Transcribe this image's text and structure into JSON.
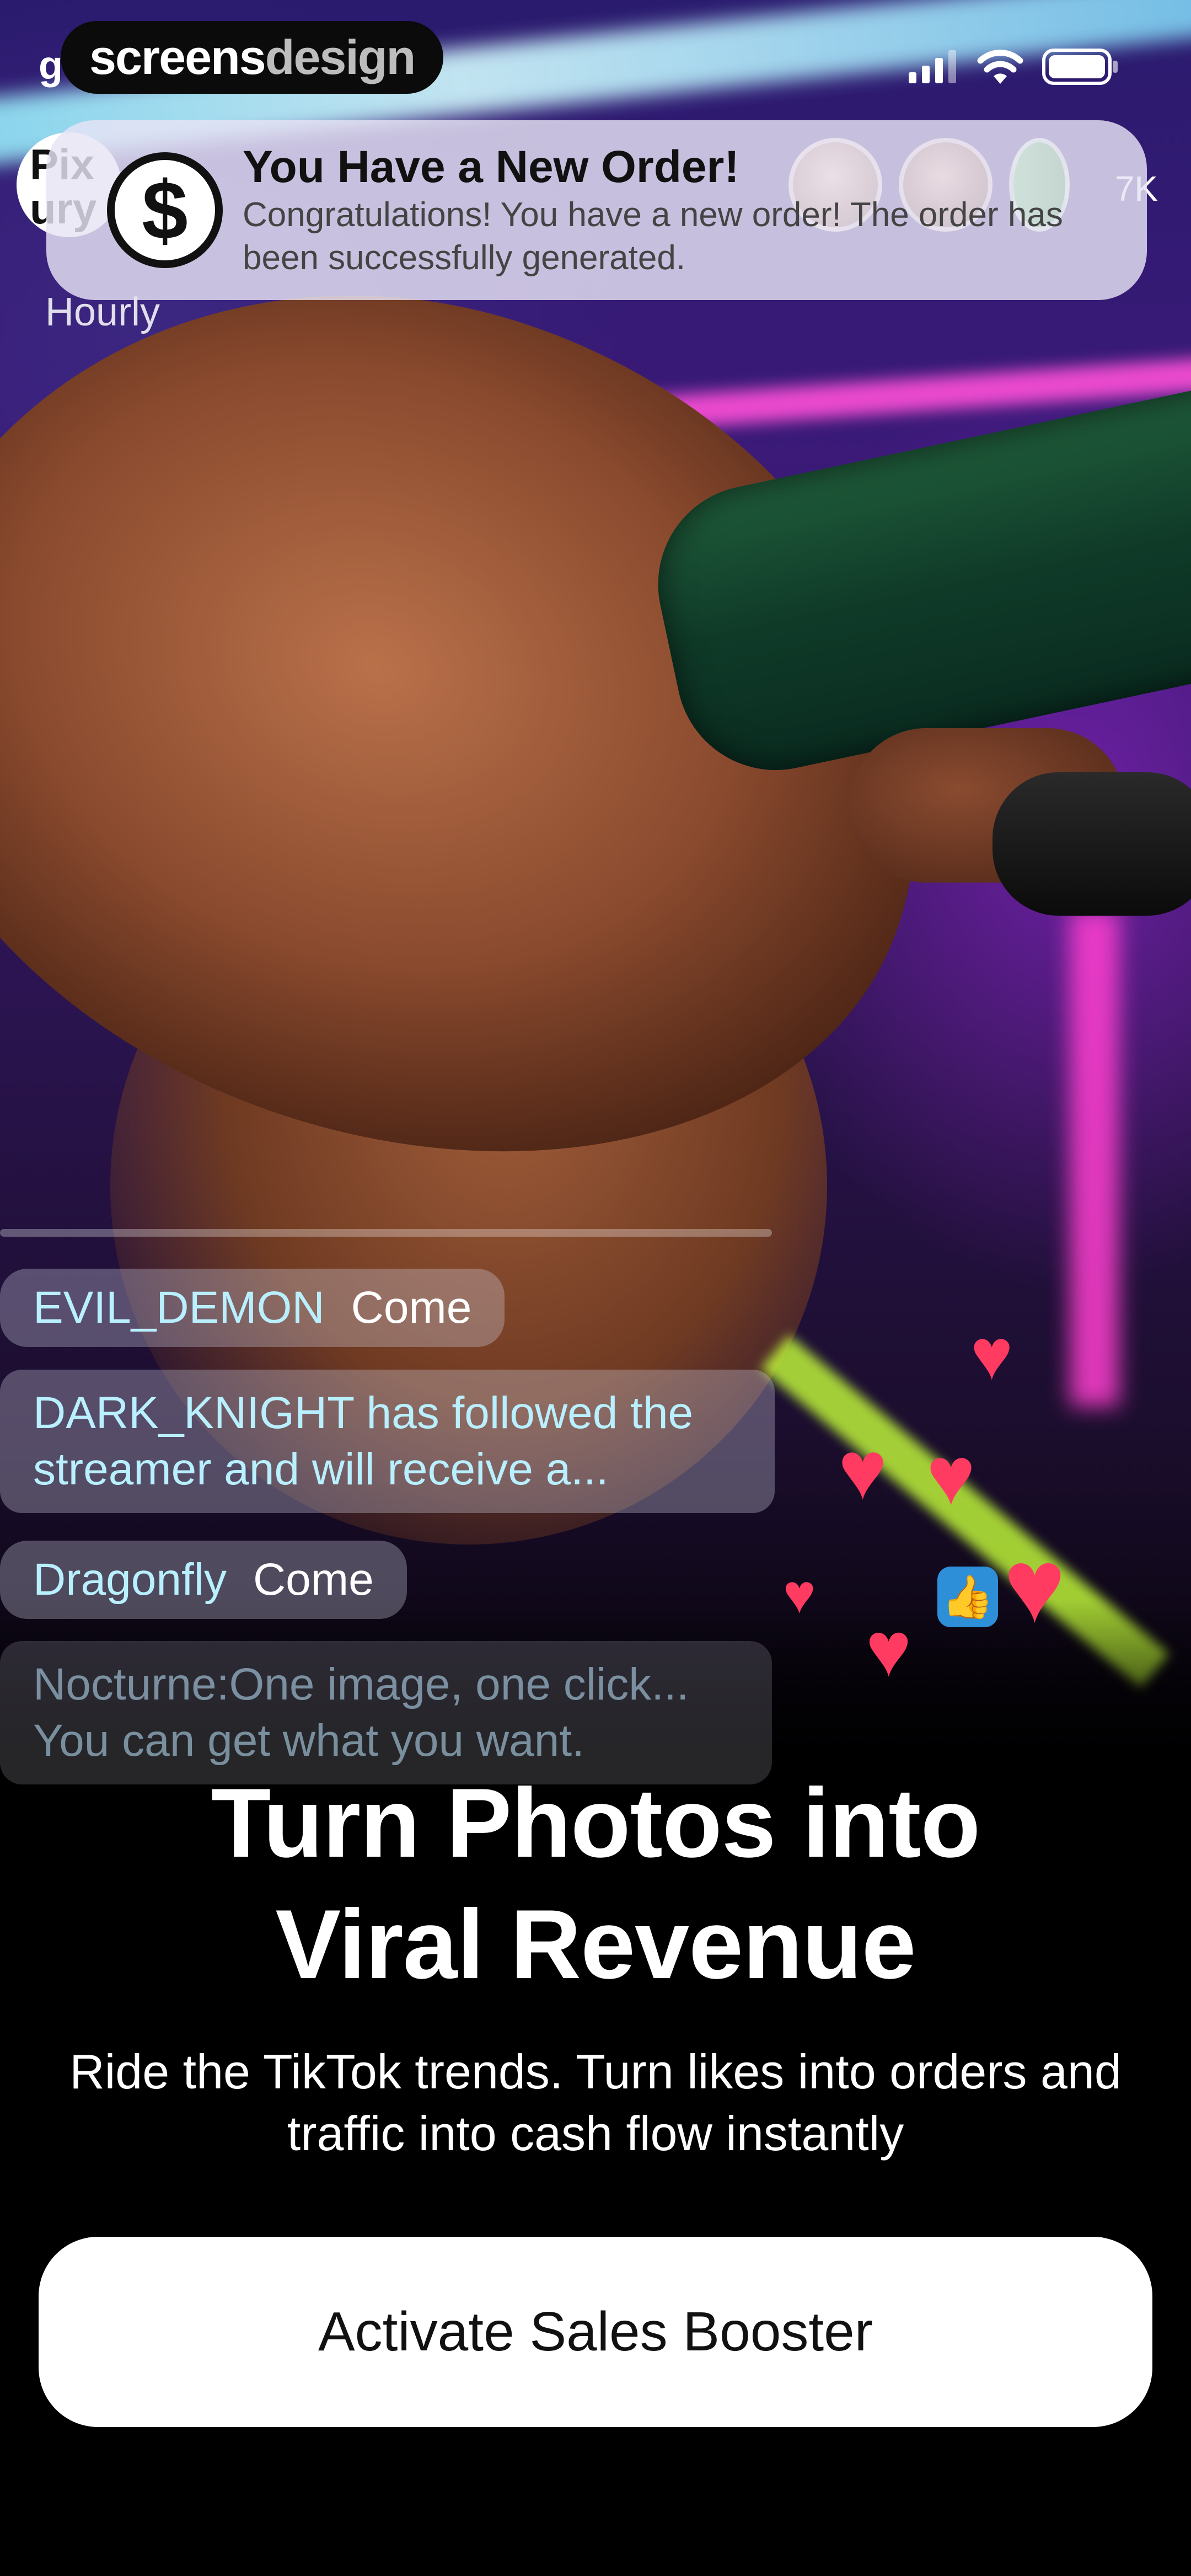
{
  "status_bar": {
    "time_fragment": "g",
    "watermark_part1": "screens",
    "watermark_part2": "design",
    "icons": [
      "cellular-signal-icon",
      "wifi-icon",
      "battery-icon"
    ]
  },
  "live_header": {
    "host_avatar_text": "Pix ury",
    "viewer_count": "7K",
    "hourly_label": "Hourly"
  },
  "notification": {
    "icon": "dollar-icon",
    "icon_glyph": "$",
    "title": "You Have a New Order!",
    "body": "Congratulations! You have a new order! The order has been successfully generated."
  },
  "chat": {
    "messages": [
      {
        "user": "EVIL_DEMON",
        "text": "Come"
      },
      {
        "user": "DARK_KNIGHT",
        "text": "has followed the streamer and will receive a..."
      },
      {
        "user": "Dragonfly",
        "text": "Come"
      }
    ],
    "faded_message": "Nocturne:One image, one click... You can get what you want."
  },
  "reactions": {
    "heart_icon": "heart-icon",
    "heart_glyph": "♥",
    "thumbs_up_icon": "thumbs-up-icon",
    "thumbs_up_glyph": "👍",
    "heart_color": "#ff3b62"
  },
  "hero": {
    "headline_line1": "Turn Photos into",
    "headline_line2": "Viral Revenue",
    "subtext": "Ride the TikTok trends. Turn likes into orders and traffic into cash flow instantly"
  },
  "cta": {
    "label": "Activate Sales Booster"
  },
  "colors": {
    "background": "#000000",
    "button_bg": "#ffffff",
    "button_text": "#111111",
    "notification_bg": "#e8e4f5",
    "chat_user": "#b9f0ff"
  }
}
